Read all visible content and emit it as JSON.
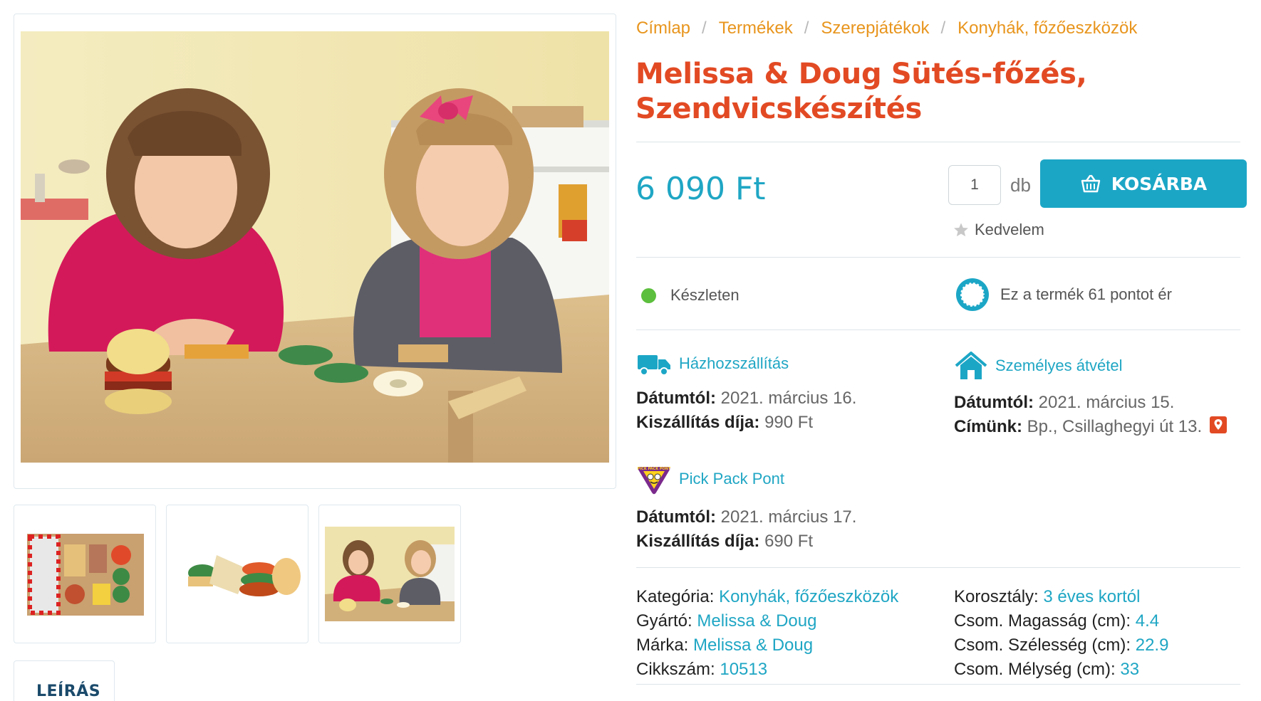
{
  "gallery": {
    "main_image_alt": "",
    "thumbnails": [
      {
        "id": "box"
      },
      {
        "id": "pieces"
      },
      {
        "id": "kids"
      }
    ]
  },
  "tabs": {
    "description": "LEÍRÁS"
  },
  "breadcrumb": {
    "items": [
      "Címlap",
      "Termékek",
      "Szerepjátékok",
      "Konyhák, főzőeszközök"
    ],
    "separator": "/"
  },
  "product": {
    "title": "Melissa & Doug Sütés-főzés, Szendvicskészítés",
    "price": "6 090 Ft",
    "quantity": "1",
    "quantity_unit": "db",
    "cart_button": "KOSÁRBA",
    "favorite_label": "Kedvelem",
    "stock_status": "Készleten",
    "points_text": "Ez a termék 61 pontot ér"
  },
  "shipping": {
    "home": {
      "title": "Házhozszállítás",
      "date_label": "Dátumtól:",
      "date": "2021. március 16.",
      "fee_label": "Kiszállítás díja:",
      "fee": "990 Ft"
    },
    "pickup": {
      "title": "Személyes átvétel",
      "date_label": "Dátumtól:",
      "date": "2021. március 15.",
      "address_label": "Címünk:",
      "address": "Bp., Csillaghegyi út 13."
    },
    "pickpack": {
      "title": "Pick Pack Pont",
      "logo_text": "PICK PACK PONT",
      "date_label": "Dátumtól:",
      "date": "2021. március 17.",
      "fee_label": "Kiszállítás díja:",
      "fee": "690 Ft"
    }
  },
  "specs": {
    "left": [
      {
        "label": "Kategória:",
        "value": "Konyhák, főzőeszközök"
      },
      {
        "label": "Gyártó:",
        "value": "Melissa & Doug"
      },
      {
        "label": "Márka:",
        "value": "Melissa & Doug"
      },
      {
        "label": "Cikkszám:",
        "value": "10513"
      }
    ],
    "right": [
      {
        "label": "Korosztály:",
        "value": "3 éves kortól"
      },
      {
        "label": "Csom. Magasság (cm):",
        "value": "4.4"
      },
      {
        "label": "Csom. Szélesség (cm):",
        "value": "22.9"
      },
      {
        "label": "Csom. Mélység (cm):",
        "value": "33"
      }
    ]
  },
  "colors": {
    "accent": "#1ca6c6",
    "title": "#e24a24",
    "breadcrumb": "#e8951d",
    "in_stock": "#5cbf3d"
  }
}
